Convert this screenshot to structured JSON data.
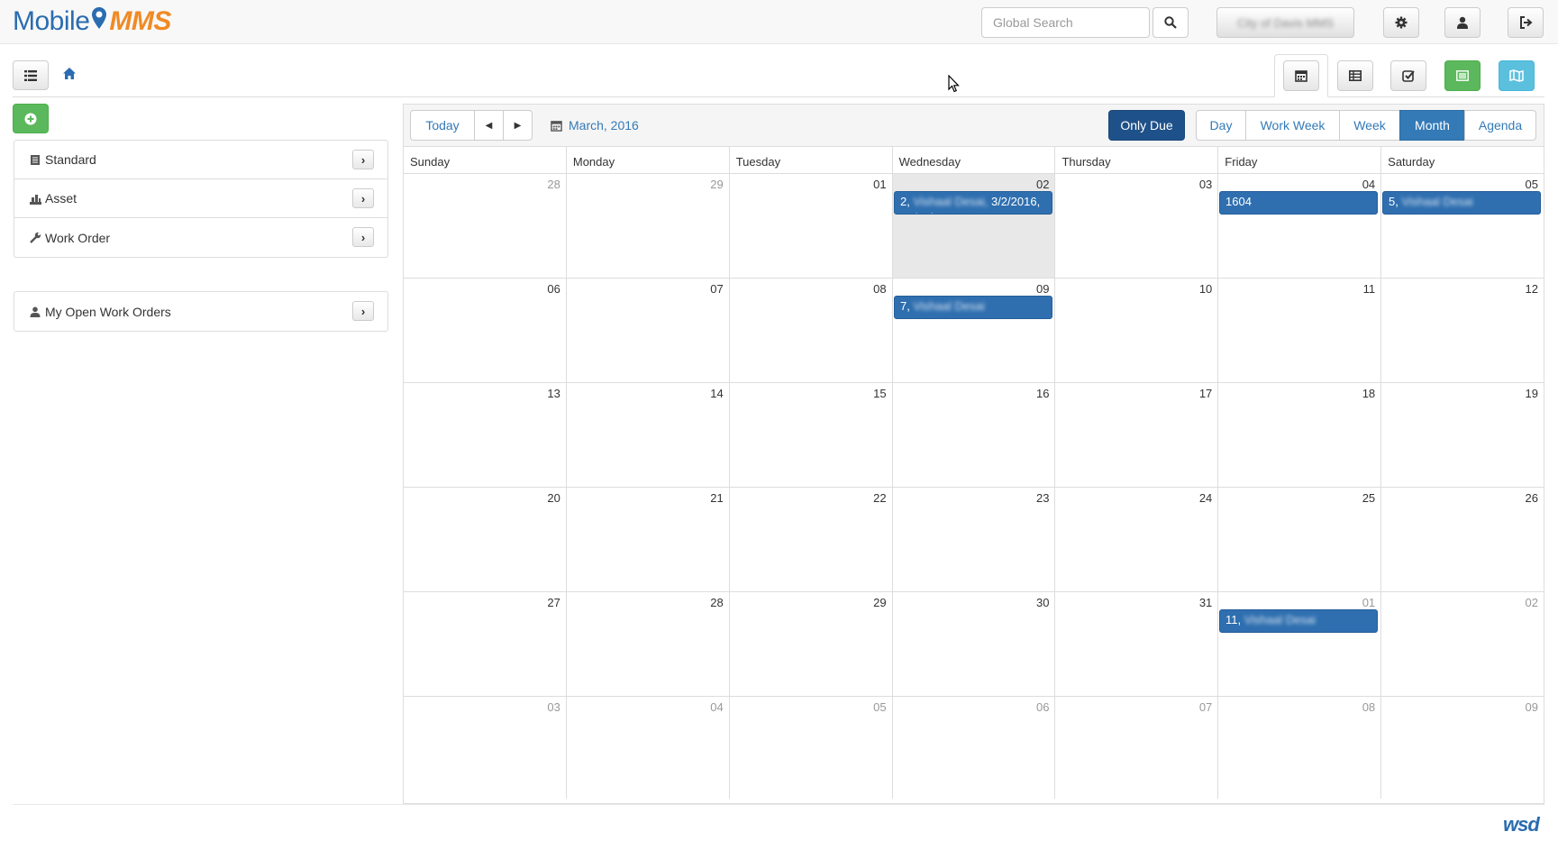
{
  "brand": {
    "part1": "Mobile",
    "part2": "MMS",
    "footer_logo": "wsd"
  },
  "header": {
    "search_placeholder": "Global Search",
    "org_selector": "City of Davis MMS",
    "icons": [
      "search-icon",
      "gear-icon",
      "user-icon",
      "logout-icon"
    ]
  },
  "view_toolbar": {
    "icons": [
      "calendar-icon",
      "table-icon",
      "checklist-icon",
      "list-icon",
      "map-icon"
    ],
    "colors": {
      "green": "#5cb85c",
      "blue": "#5bc0de"
    }
  },
  "sidebar": {
    "sections": [
      {
        "label": "Standard",
        "icon": "document-icon"
      },
      {
        "label": "Asset",
        "icon": "asset-icon"
      },
      {
        "label": "Work Order",
        "icon": "wrench-icon"
      }
    ],
    "my_section": {
      "label": "My Open Work Orders",
      "icon": "user-icon"
    }
  },
  "calendar": {
    "today_label": "Today",
    "month_label": "March, 2016",
    "only_due_label": "Only Due",
    "views": [
      "Day",
      "Work Week",
      "Week",
      "Month",
      "Agenda"
    ],
    "active_view": "Month",
    "weekdays": [
      "Sunday",
      "Monday",
      "Tuesday",
      "Wednesday",
      "Thursday",
      "Friday",
      "Saturday"
    ],
    "weeks": [
      [
        "28",
        "29",
        "01",
        "02",
        "03",
        "04",
        "05"
      ],
      [
        "06",
        "07",
        "08",
        "09",
        "10",
        "11",
        "12"
      ],
      [
        "13",
        "14",
        "15",
        "16",
        "17",
        "18",
        "19"
      ],
      [
        "20",
        "21",
        "22",
        "23",
        "24",
        "25",
        "26"
      ],
      [
        "27",
        "28",
        "29",
        "30",
        "31",
        "01",
        "02"
      ],
      [
        "03",
        "04",
        "05",
        "06",
        "07",
        "08",
        "09"
      ]
    ],
    "events": {
      "e1": {
        "prefix": "2,",
        "name": "Vishaal Desai,",
        "suffix": "3/2/2016,",
        "line2": "owiaoinaa"
      },
      "e2": {
        "prefix": "1604"
      },
      "e3": {
        "prefix": "5,",
        "name": "Vishaal Desai"
      },
      "e4": {
        "prefix": "7,",
        "name": "Vishaal Desai"
      },
      "e5": {
        "prefix": "11,",
        "name": "Vishaal Desai"
      }
    },
    "event_color": "#2f6fb0"
  }
}
